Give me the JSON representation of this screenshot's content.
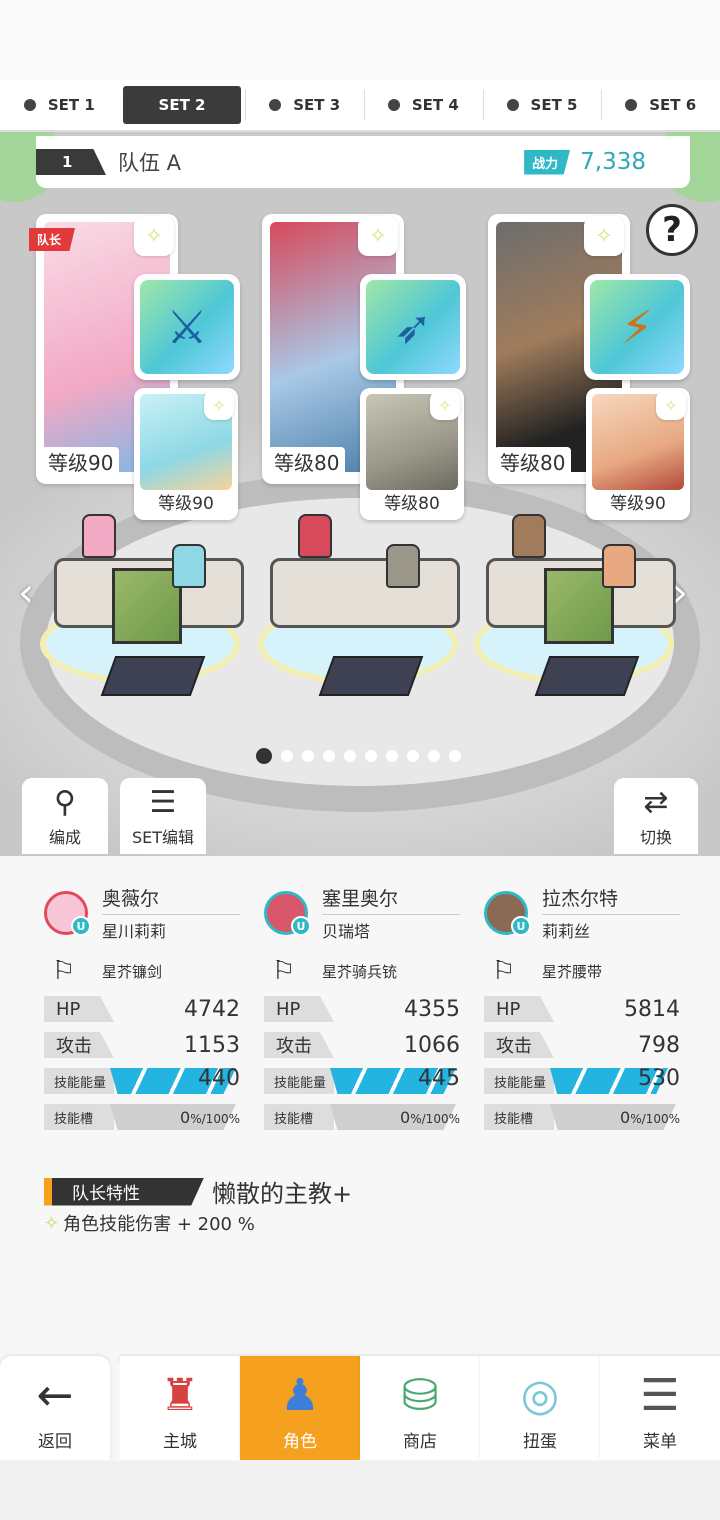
{
  "sets": [
    {
      "label": "SET 1",
      "active": false
    },
    {
      "label": "SET 2",
      "active": true
    },
    {
      "label": "SET 3",
      "active": false
    },
    {
      "label": "SET 4",
      "active": false
    },
    {
      "label": "SET 5",
      "active": false
    },
    {
      "label": "SET 6",
      "active": false
    }
  ],
  "team": {
    "number": "1",
    "name": "队伍 A",
    "power_label": "战力",
    "power_value": "7,338"
  },
  "help_label": "?",
  "captain_badge": "队长",
  "cards": [
    {
      "level": "等级90",
      "sub_level": "等级90",
      "gear_icon": "sword-icon",
      "portrait_color": "#f7c7d8",
      "sub_color": "#a9e1ea"
    },
    {
      "level": "等级80",
      "sub_level": "等级80",
      "gear_icon": "rifle-icon",
      "portrait_color": "#d8576b",
      "sub_color": "#b5b3a4"
    },
    {
      "level": "等级80",
      "sub_level": "等级90",
      "gear_icon": "belt-icon",
      "portrait_color": "#8a6a52",
      "sub_color": "#f2c7a8"
    }
  ],
  "pager": {
    "count": 10,
    "current": 0
  },
  "stage_buttons": {
    "formation": "编成",
    "set_edit": "SET编辑",
    "switch": "切换"
  },
  "characters": [
    {
      "name": "奥薇尔",
      "sub_name": "星川莉莉",
      "equip": "星芥镰剑",
      "hp_label": "HP",
      "hp": "4742",
      "atk_label": "攻击",
      "atk": "1153",
      "energy_label": "技能能量",
      "energy": "440",
      "energy_fill": 0.75,
      "slot_label": "技能槽",
      "slot_value": "0",
      "slot_unit": "%/100%",
      "avatar_color": "#f7c7d8",
      "ring_color": "#e24a5a"
    },
    {
      "name": "塞里奥尔",
      "sub_name": "贝瑞塔",
      "equip": "星芥骑兵铳",
      "hp_label": "HP",
      "hp": "4355",
      "atk_label": "攻击",
      "atk": "1066",
      "energy_label": "技能能量",
      "energy": "445",
      "energy_fill": 0.75,
      "slot_label": "技能槽",
      "slot_value": "0",
      "slot_unit": "%/100%",
      "avatar_color": "#d8576b",
      "ring_color": "#2fb8c6"
    },
    {
      "name": "拉杰尔特",
      "sub_name": "莉莉丝",
      "equip": "星芥腰带",
      "hp_label": "HP",
      "hp": "5814",
      "atk_label": "攻击",
      "atk": "798",
      "energy_label": "技能能量",
      "energy": "530",
      "energy_fill": 0.7,
      "slot_label": "技能槽",
      "slot_value": "0",
      "slot_unit": "%/100%",
      "avatar_color": "#8a6a52",
      "ring_color": "#2fb8c6"
    }
  ],
  "leader": {
    "label": "队长特性",
    "title": "懒散的主教+",
    "desc": "角色技能伤害 + 200 %"
  },
  "bottom_nav": {
    "back": "返回",
    "items": [
      {
        "label": "主城",
        "icon": "castle-icon",
        "active": false
      },
      {
        "label": "角色",
        "icon": "character-icon",
        "active": true
      },
      {
        "label": "商店",
        "icon": "shop-icon",
        "active": false
      },
      {
        "label": "扭蛋",
        "icon": "gacha-icon",
        "active": false
      },
      {
        "label": "菜单",
        "icon": "menu-icon",
        "active": false
      }
    ]
  },
  "colors": {
    "accent": "#2fb8c6",
    "orange": "#f6a020",
    "captain": "#e23a3a",
    "energy": "#23b4e0"
  }
}
